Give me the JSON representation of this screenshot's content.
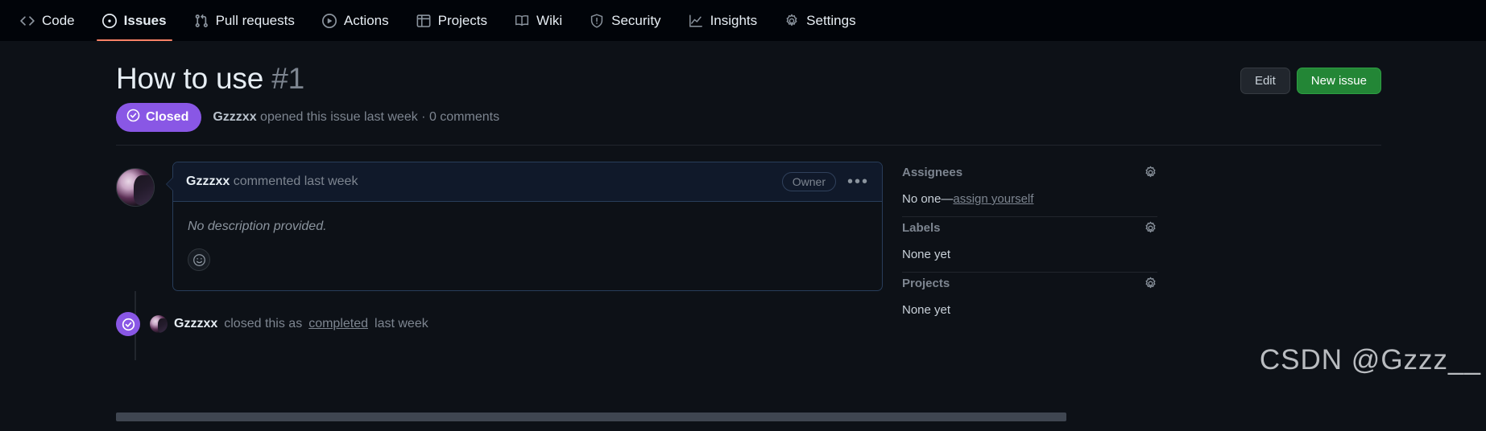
{
  "nav": {
    "items": [
      {
        "label": "Code",
        "icon": "code-icon",
        "selected": false
      },
      {
        "label": "Issues",
        "icon": "issue-opened-icon",
        "selected": true
      },
      {
        "label": "Pull requests",
        "icon": "git-pull-request-icon",
        "selected": false
      },
      {
        "label": "Actions",
        "icon": "play-icon",
        "selected": false
      },
      {
        "label": "Projects",
        "icon": "table-icon",
        "selected": false
      },
      {
        "label": "Wiki",
        "icon": "book-icon",
        "selected": false
      },
      {
        "label": "Security",
        "icon": "shield-icon",
        "selected": false
      },
      {
        "label": "Insights",
        "icon": "graph-icon",
        "selected": false
      },
      {
        "label": "Settings",
        "icon": "gear-icon",
        "selected": false
      }
    ]
  },
  "issue": {
    "title": "How to use",
    "number": "#1",
    "state": "Closed",
    "state_color": "#8957e5",
    "meta_author": "Gzzzxx",
    "meta_rest": "opened this issue last week · 0 comments",
    "edit_label": "Edit",
    "new_issue_label": "New issue",
    "new_issue_color": "#238636"
  },
  "comment": {
    "author": "Gzzzxx",
    "action": "commented last week",
    "owner_badge": "Owner",
    "menu": "•••",
    "body": "No description provided.",
    "reaction_icon": "smiley-icon"
  },
  "timeline": {
    "author": "Gzzzxx",
    "text_before": "closed this as",
    "link": "completed",
    "text_after": "last week",
    "icon": "check-circle-icon",
    "icon_color": "#8957e5"
  },
  "sidebar": {
    "sections": [
      {
        "title": "Assignees",
        "value_prefix": "No one—",
        "value_link": "assign yourself",
        "value": "",
        "gear": "gear-icon"
      },
      {
        "title": "Labels",
        "value_prefix": "",
        "value_link": "",
        "value": "None yet",
        "gear": "gear-icon"
      },
      {
        "title": "Projects",
        "value_prefix": "",
        "value_link": "",
        "value": "None yet",
        "gear": "gear-icon"
      }
    ]
  },
  "watermark": "CSDN @Gzzz__"
}
